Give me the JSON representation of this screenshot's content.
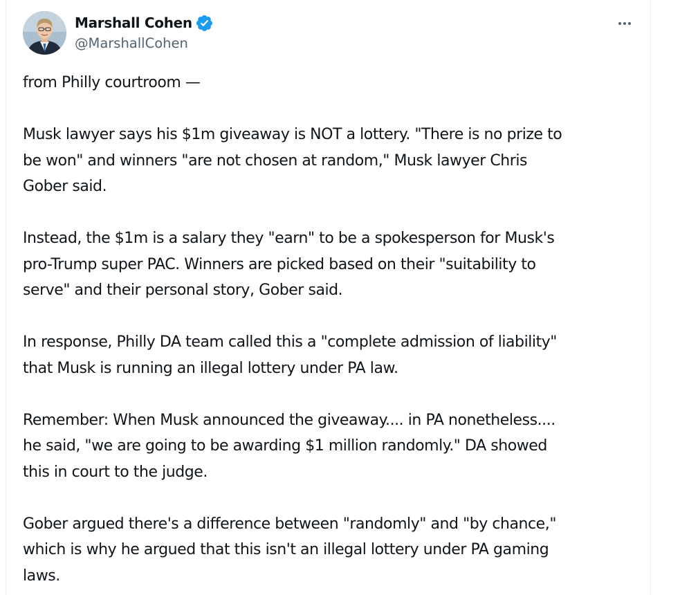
{
  "tweet": {
    "author": {
      "display_name": "Marshall Cohen",
      "handle": "@MarshallCohen",
      "verified": true
    },
    "accent_color": "#1d9bf0",
    "paragraphs": [
      [
        "from Philly courtroom —"
      ],
      [
        "Musk lawyer says his $1m giveaway is NOT a lottery. \"There is no prize to",
        "be won\" and winners \"are not chosen at random,\" Musk lawyer Chris",
        "Gober said."
      ],
      [
        "Instead, the $1m is a salary they \"earn\" to be a spokesperson for Musk's",
        "pro-Trump super PAC. Winners are picked based on their \"suitability to",
        "serve\" and their personal story, Gober said."
      ],
      [
        "In response, Philly DA team called this a \"complete admission of liability\"",
        "that Musk is running an illegal lottery under PA law."
      ],
      [
        "Remember: When Musk announced the giveaway.... in PA nonetheless....",
        "he said, \"we are going to be awarding $1 million randomly.\" DA showed",
        "this in court to the judge."
      ],
      [
        "Gober argued there's a difference between \"randomly\" and \"by chance,\"",
        "which is why he argued that this isn't an illegal lottery under PA gaming",
        "laws."
      ]
    ],
    "icons": {
      "verified": "verified-badge-icon",
      "more": "more-options-icon"
    }
  }
}
